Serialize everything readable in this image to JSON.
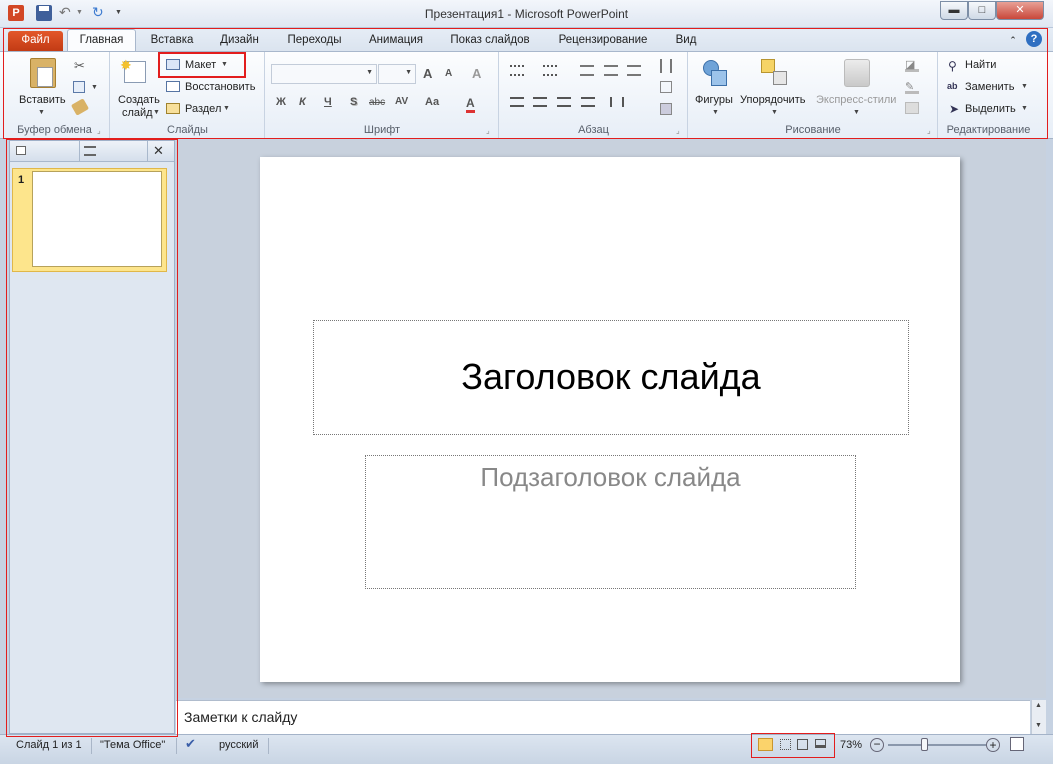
{
  "window": {
    "title": "Презентация1  -  Microsoft PowerPoint",
    "minimize": "▬",
    "maximize": "□",
    "close": "✕"
  },
  "tabs": [
    {
      "label": "Файл"
    },
    {
      "label": "Главная"
    },
    {
      "label": "Вставка"
    },
    {
      "label": "Дизайн"
    },
    {
      "label": "Переходы"
    },
    {
      "label": "Анимация"
    },
    {
      "label": "Показ слайдов"
    },
    {
      "label": "Рецензирование"
    },
    {
      "label": "Вид"
    }
  ],
  "ribbon": {
    "clipboard": {
      "label": "Буфер обмена",
      "paste": "Вставить"
    },
    "slides": {
      "label": "Слайды",
      "new_slide_1": "Создать",
      "new_slide_2": "слайд",
      "layout": "Макет",
      "reset": "Восстановить",
      "section": "Раздел"
    },
    "font": {
      "label": "Шрифт",
      "bold": "Ж",
      "italic": "К",
      "underline": "Ч",
      "shadow": "S",
      "strike": "abc",
      "spacing": "AV",
      "case": "Aa",
      "grow": "A",
      "shrink": "A",
      "clear": "A"
    },
    "paragraph": {
      "label": "Абзац"
    },
    "drawing": {
      "label": "Рисование",
      "shapes": "Фигуры",
      "arrange": "Упорядочить",
      "quick_styles": "Экспресс-стили"
    },
    "editing": {
      "label": "Редактирование",
      "find": "Найти",
      "replace": "Заменить",
      "select": "Выделить"
    }
  },
  "thumbnails": [
    {
      "number": "1"
    }
  ],
  "slide": {
    "title": "Заголовок слайда",
    "subtitle": "Подзаголовок слайда"
  },
  "notes": {
    "placeholder": "Заметки к слайду"
  },
  "status": {
    "slide_info": "Слайд 1 из 1",
    "theme": "\"Тема Office\"",
    "language": "русский",
    "zoom": "73%",
    "zoom_level": 0.36
  },
  "colors": {
    "file_tab": "#d24a1e",
    "highlight": "#e21d1d",
    "thumbnail_selected": "#fde58c"
  }
}
